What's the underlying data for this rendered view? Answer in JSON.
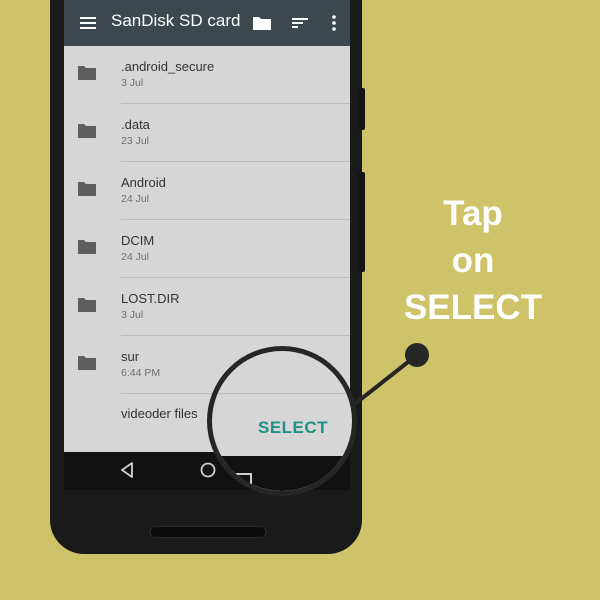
{
  "toolbar": {
    "title": "SanDisk SD card",
    "icons": [
      "menu-icon",
      "folder-icon",
      "sort-icon",
      "more-icon"
    ]
  },
  "files": [
    {
      "name": ".android_secure",
      "date": "3 Jul"
    },
    {
      "name": ".data",
      "date": "23 Jul"
    },
    {
      "name": "Android",
      "date": "24 Jul"
    },
    {
      "name": "DCIM",
      "date": "24 Jul"
    },
    {
      "name": "LOST.DIR",
      "date": "3 Jul"
    },
    {
      "name": "sur",
      "date": "6:44 PM"
    },
    {
      "name": "videoder files",
      "date": ""
    }
  ],
  "select_button": {
    "label": "SELECT"
  },
  "instruction": {
    "line1": "Tap",
    "line2": "on",
    "line3": "SELECT"
  },
  "colors": {
    "background": "#cfc36a",
    "toolbar": "#3d474e",
    "screen": "#d6d6d6",
    "select_accent": "#1f9182",
    "instruction_text": "#ffffff"
  }
}
